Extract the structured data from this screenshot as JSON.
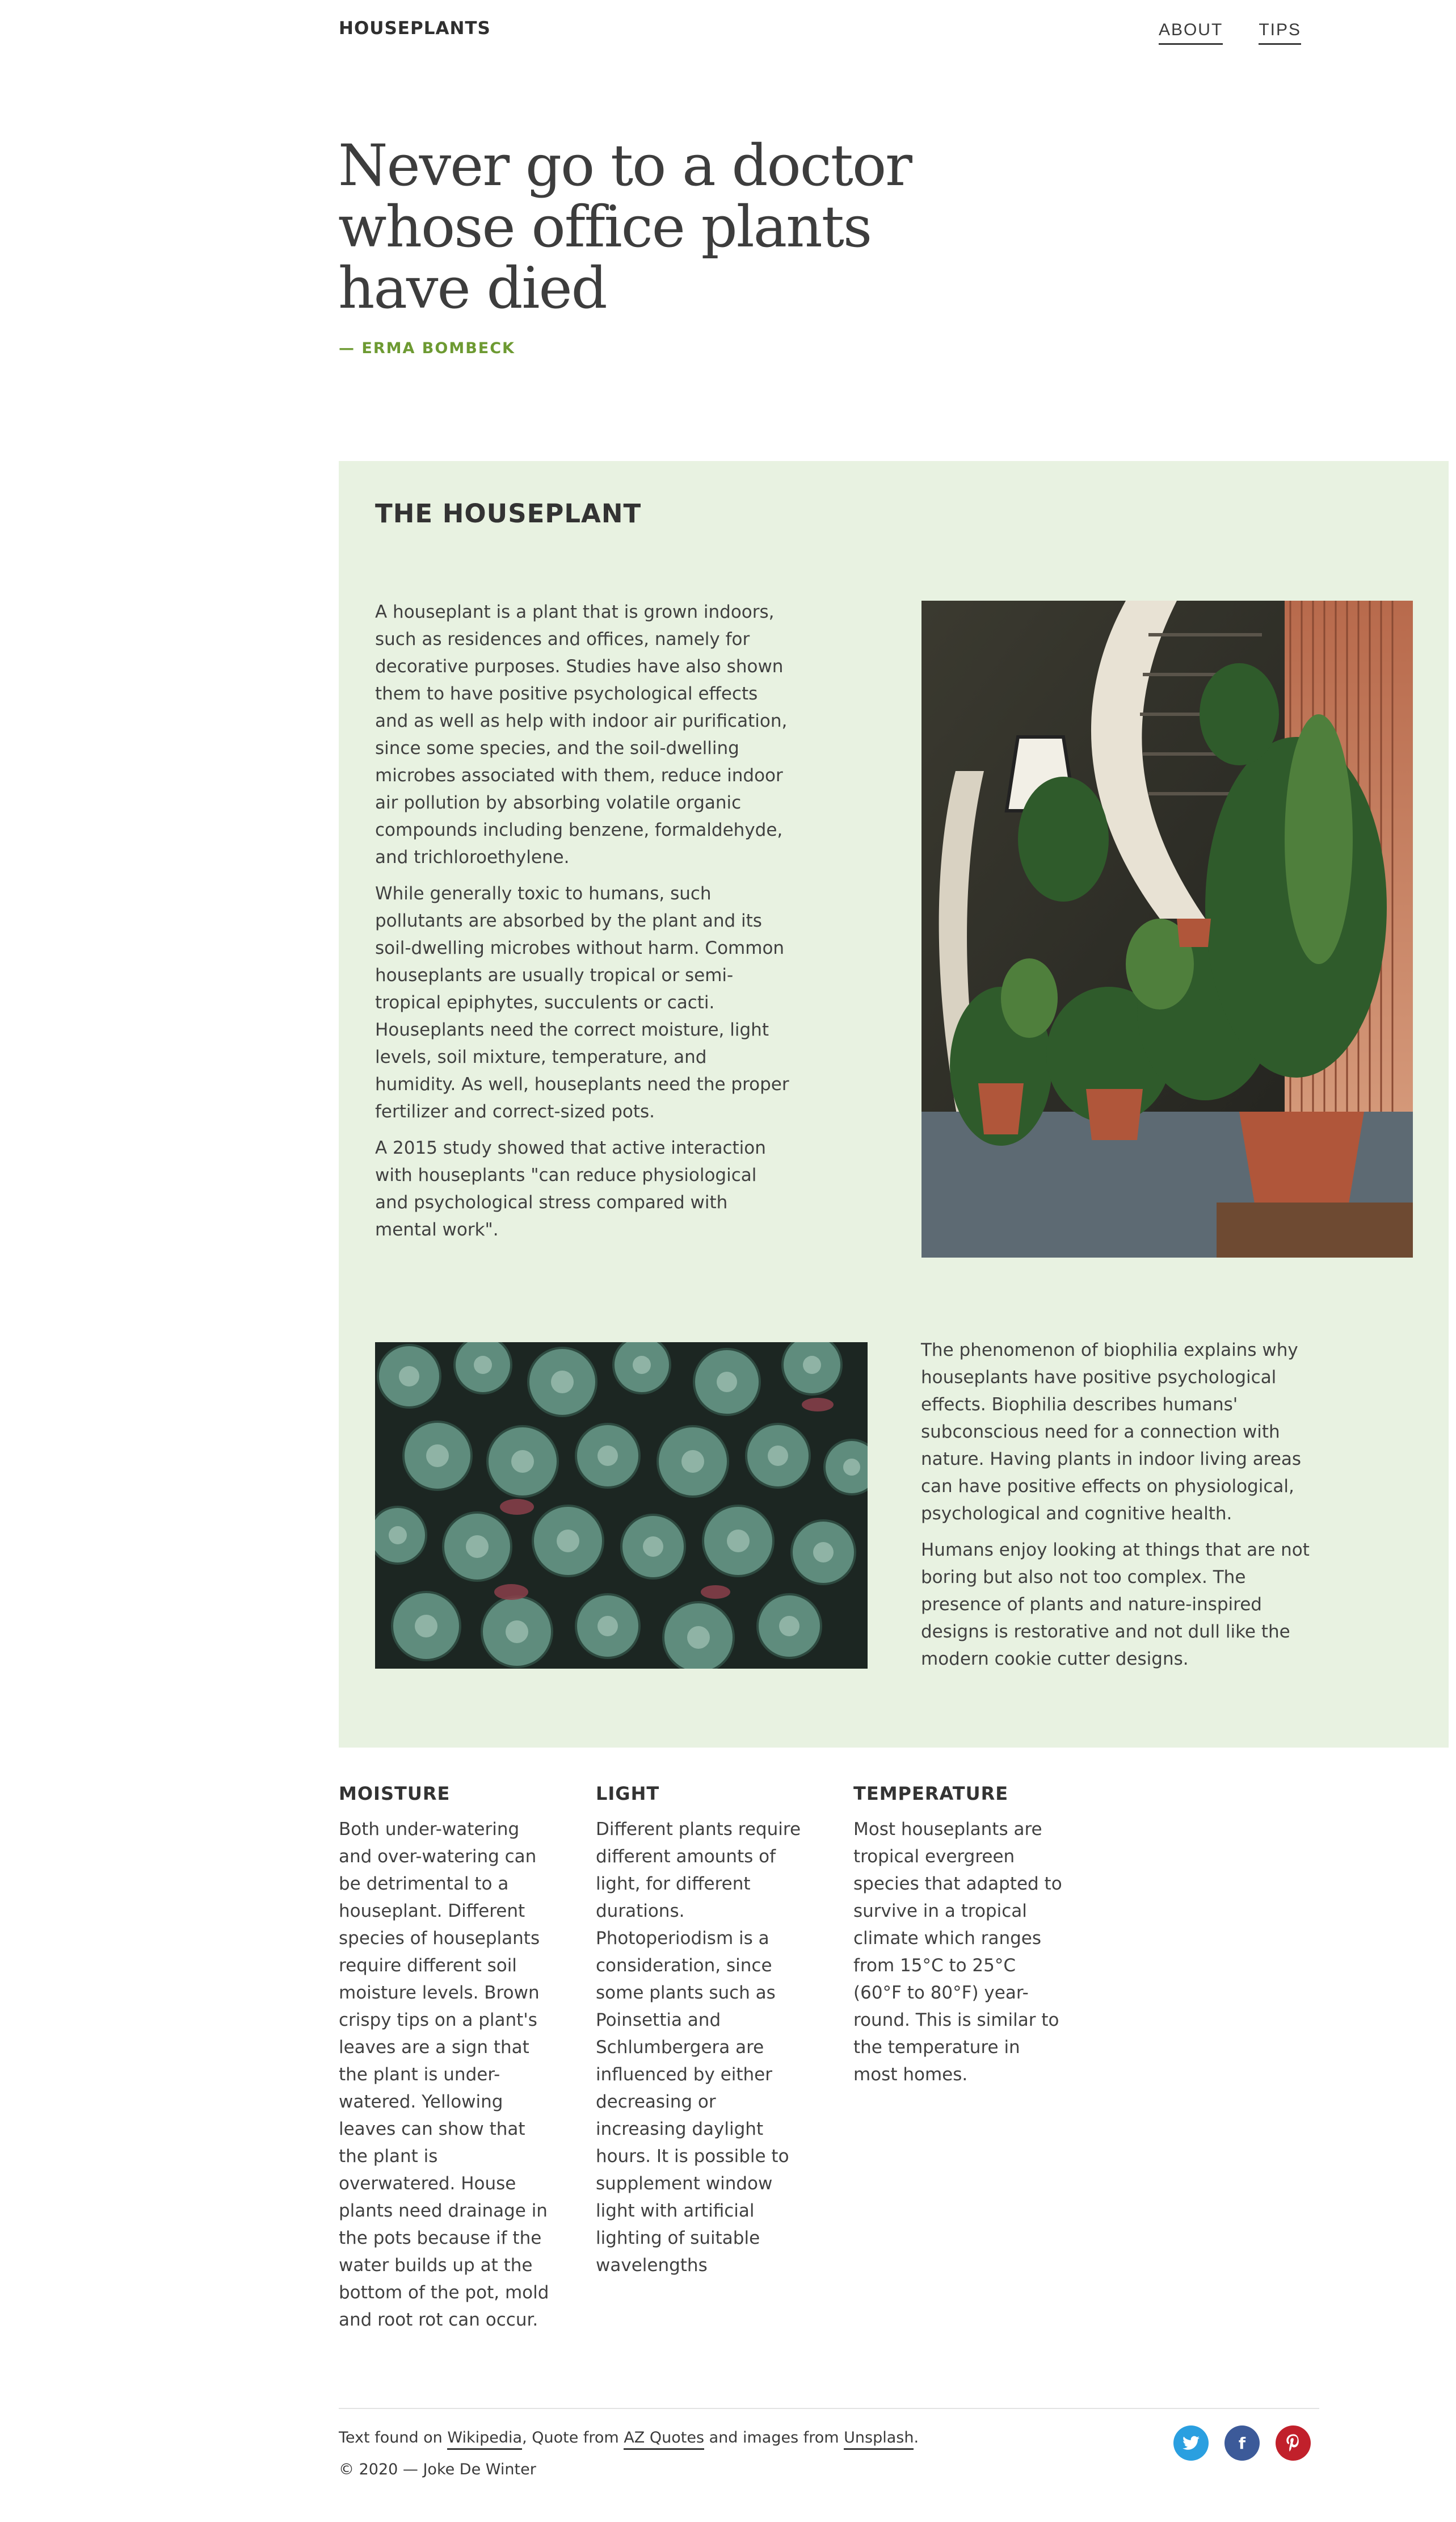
{
  "header": {
    "brand": "HOUSEPLANTS",
    "nav": [
      {
        "label": "ABOUT"
      },
      {
        "label": "TIPS"
      }
    ]
  },
  "hero": {
    "quote": "Never go to a doctor whose office plants have died",
    "author": "— ERMA BOMBECK"
  },
  "houseplant": {
    "title": "THE HOUSEPLANT",
    "intro_paragraphs": [
      "A houseplant is a plant that is grown indoors, such as residences and offices, namely for decorative purposes. Studies have also shown them to have positive psychological effects and as well as help with indoor air purification, since some species, and the soil-dwelling microbes associated with them, reduce indoor air pollution by absorbing volatile organic compounds including benzene, formaldehyde, and trichloroethylene.",
      "While generally toxic to humans, such pollutants are absorbed by the plant and its soil-dwelling microbes without harm. Common houseplants are usually tropical or semi-tropical epiphytes, succulents or cacti. Houseplants need the correct moisture, light levels, soil mixture, temperature, and humidity. As well, houseplants need the proper fertilizer and correct-sized pots.",
      "A 2015 study showed that active interaction with houseplants \"can reduce physiological and psychological stress compared with mental work\"."
    ],
    "biophilia_paragraphs": [
      "The phenomenon of biophilia explains why houseplants have positive psychological effects. Biophilia describes humans' subconscious need for a connection with nature. Having plants in indoor living areas can have positive effects on physiological, psychological and cognitive health.",
      "Humans enjoy looking at things that are not boring but also not too complex. The presence of plants and nature-inspired designs is restorative and not dull like the modern cookie cutter designs."
    ],
    "accent_bg": "#e8f2e1"
  },
  "features": [
    {
      "title": "MOISTURE",
      "text": "Both under-watering and over-watering can be detrimental to a houseplant. Different species of houseplants require different soil moisture levels. Brown crispy tips on a plant's leaves are a sign that the plant is under-watered. Yellowing leaves can show that the plant is overwatered. House plants need drainage in the pots because if the water builds up at the bottom of the pot, mold and root rot can occur."
    },
    {
      "title": "LIGHT",
      "text": "Different plants require different amounts of light, for different durations. Photoperiodism is a consideration, since some plants such as Poinsettia and Schlumbergera are influenced by either decreasing or increasing daylight hours. It is possible to supplement window light with artificial lighting of suitable wavelengths"
    },
    {
      "title": "TEMPERATURE",
      "text": "Most houseplants are tropical evergreen species that adapted to survive in a tropical climate which ranges from 15°C to 25°C (60°F to 80°F) year-round. This is similar to the temperature in most homes."
    }
  ],
  "footer": {
    "credit_prefix": "Text found on ",
    "link_wikipedia": "Wikipedia",
    "credit_mid1": ", Quote from ",
    "link_azquotes": "AZ Quotes",
    "credit_mid2": " and images from ",
    "link_unsplash": "Unsplash",
    "credit_suffix": ".",
    "copyright": "© 2020 — Joke De Winter",
    "social": [
      {
        "icon": "twitter-icon",
        "glyph": "🐦",
        "color": "#2a9fe0"
      },
      {
        "icon": "facebook-icon",
        "glyph": "f",
        "color": "#3c5a99"
      },
      {
        "icon": "pinterest-icon",
        "glyph": "P",
        "color": "#c1202b"
      }
    ]
  },
  "colors": {
    "accent_green": "#6d9a32",
    "text": "#3a3a3a"
  }
}
